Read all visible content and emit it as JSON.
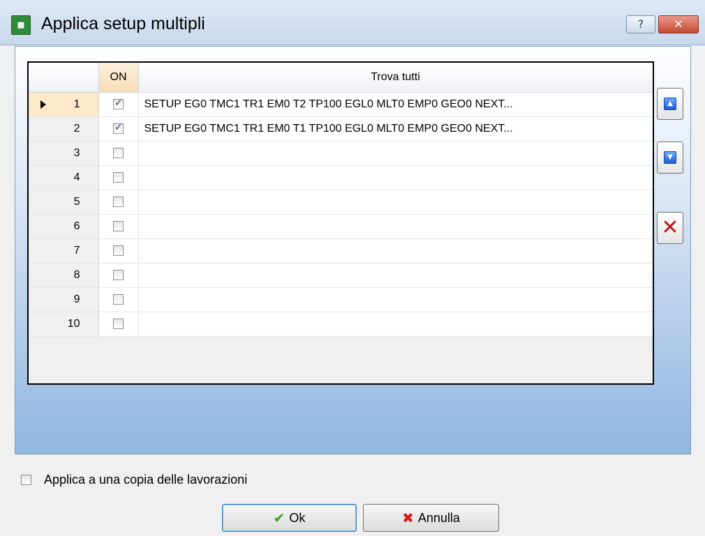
{
  "window": {
    "title": "Applica setup multipli",
    "icon": "app-icon",
    "help_label": "?",
    "close_label": "✕"
  },
  "grid": {
    "columns": [
      "",
      "ON",
      "Trova tutti"
    ],
    "rows": [
      {
        "num": "1",
        "on": true,
        "text": "SETUP EG0 TMC1 TR1 EM0 T2 TP100 EGL0 MLT0 EMP0 GEO0 NEXT...",
        "selected": true
      },
      {
        "num": "2",
        "on": true,
        "text": "SETUP EG0 TMC1 TR1 EM0 T1 TP100 EGL0 MLT0 EMP0 GEO0 NEXT..."
      },
      {
        "num": "3",
        "on": false,
        "text": ""
      },
      {
        "num": "4",
        "on": false,
        "text": ""
      },
      {
        "num": "5",
        "on": false,
        "text": ""
      },
      {
        "num": "6",
        "on": false,
        "text": ""
      },
      {
        "num": "7",
        "on": false,
        "text": ""
      },
      {
        "num": "8",
        "on": false,
        "text": ""
      },
      {
        "num": "9",
        "on": false,
        "text": ""
      },
      {
        "num": "10",
        "on": false,
        "text": ""
      }
    ]
  },
  "side_buttons": {
    "move_up_icon": "arrow-up-icon",
    "move_down_icon": "arrow-down-icon",
    "delete_icon": "delete-x-icon"
  },
  "options": {
    "apply_copy_label": "Applica a una copia delle lavorazioni",
    "apply_copy_checked": false
  },
  "buttons": {
    "ok_label": "Ok",
    "cancel_label": "Annulla"
  }
}
